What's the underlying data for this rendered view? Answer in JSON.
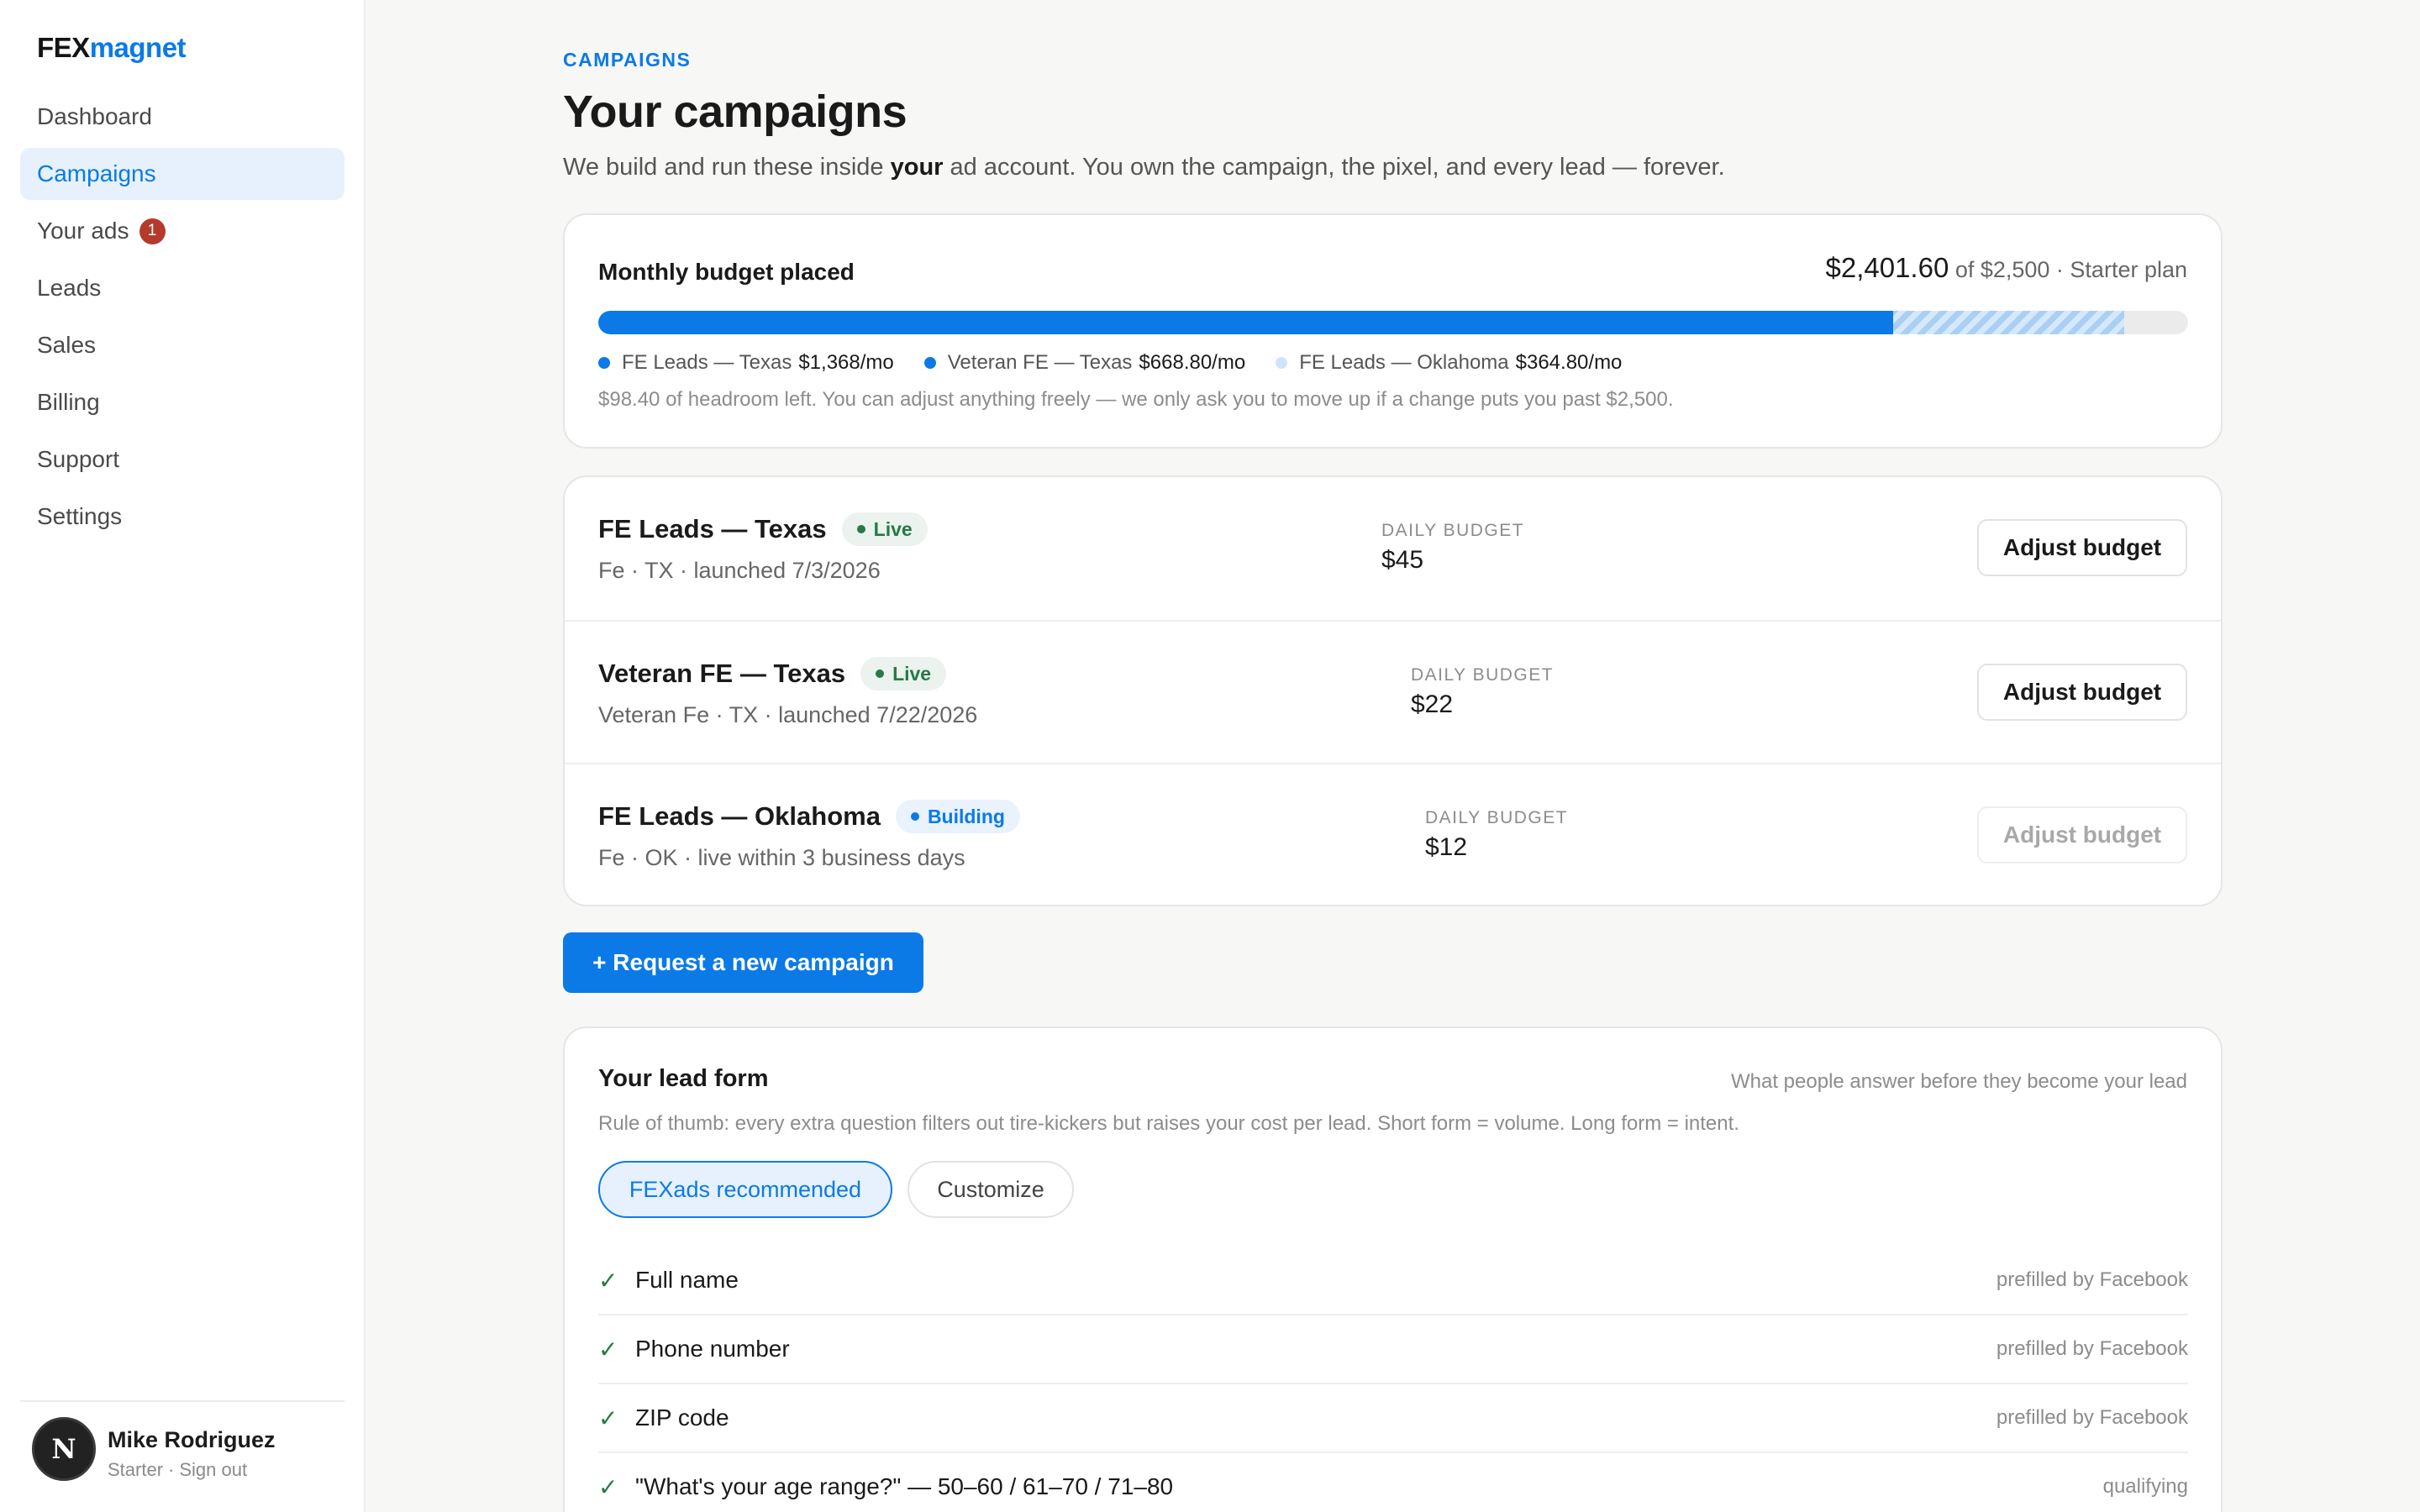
{
  "brand": {
    "part1": "FEX",
    "part2": "magnet",
    "accent": "#0b7ae6"
  },
  "nav": [
    {
      "label": "Dashboard",
      "active": false
    },
    {
      "label": "Campaigns",
      "active": true
    },
    {
      "label": "Your ads",
      "active": false,
      "badge": "1"
    },
    {
      "label": "Leads",
      "active": false
    },
    {
      "label": "Sales",
      "active": false
    },
    {
      "label": "Billing",
      "active": false
    },
    {
      "label": "Support",
      "active": false
    },
    {
      "label": "Settings",
      "active": false
    }
  ],
  "user": {
    "name": "Mike Rodriguez",
    "avatar_letter": "N",
    "plan": "Starter",
    "sign_out": "Sign out"
  },
  "page": {
    "eyebrow": "CAMPAIGNS",
    "title": "Your campaigns",
    "intro_pre": "We build and run these inside ",
    "intro_bold": "your",
    "intro_post": " ad account. You own the campaign, the pixel, and every lead — forever."
  },
  "budget": {
    "title": "Monthly budget placed",
    "placed": "$2,401.60",
    "of_text": "of $2,500 · Starter plan",
    "live_fraction": 0.8144,
    "building_fraction": 0.1456,
    "legend": [
      {
        "name": "FE Leads — Texas",
        "value": "$1,368/mo",
        "color": "#0b7ae6"
      },
      {
        "name": "Veteran FE — Texas",
        "value": "$668.80/mo",
        "color": "#0b7ae6"
      },
      {
        "name": "FE Leads — Oklahoma",
        "value": "$364.80/mo",
        "color": "#cfe4fb"
      }
    ],
    "headroom": "$98.40 of headroom left. You can adjust anything freely — we only ask you to move up if a change puts you past $2,500."
  },
  "campaigns": [
    {
      "name": "FE Leads — Texas",
      "status": "Live",
      "meta": "Fe · TX · launched 7/3/2026",
      "daily_label": "DAILY BUDGET",
      "daily": "$45",
      "button": "Adjust budget",
      "enabled": true
    },
    {
      "name": "Veteran FE — Texas",
      "status": "Live",
      "meta": "Veteran Fe · TX · launched 7/22/2026",
      "daily_label": "DAILY BUDGET",
      "daily": "$22",
      "button": "Adjust budget",
      "enabled": true
    },
    {
      "name": "FE Leads — Oklahoma",
      "status": "Building",
      "meta": "Fe · OK · live within 3 business days",
      "daily_label": "DAILY BUDGET",
      "daily": "$12",
      "button": "Adjust budget",
      "enabled": false
    }
  ],
  "request_button": "+ Request a new campaign",
  "lead_form": {
    "title": "Your lead form",
    "subtitle": "What people answer before they become your lead",
    "hint": "Rule of thumb: every extra question filters out tire-kickers but raises your cost per lead. Short form = volume. Long form = intent.",
    "option_recommended": "FEXads recommended",
    "option_customize": "Customize",
    "questions": [
      {
        "text": "Full name",
        "tag": "prefilled by Facebook"
      },
      {
        "text": "Phone number",
        "tag": "prefilled by Facebook"
      },
      {
        "text": "ZIP code",
        "tag": "prefilled by Facebook"
      },
      {
        "text": "\"What's your age range?\" — 50–60 / 61–70 / 71–80",
        "tag": "qualifying"
      }
    ]
  }
}
